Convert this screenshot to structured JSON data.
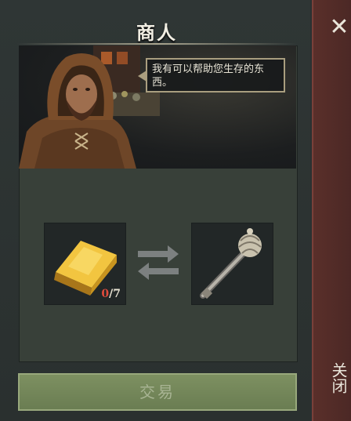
{
  "dialog": {
    "title": "商人",
    "speech": "我有可以帮助您生存的东西。"
  },
  "trade": {
    "offer_item": "gold-bar",
    "offer_have": "0",
    "offer_sep": "/",
    "offer_need": "7",
    "receive_item": "mace",
    "button_label": "交易"
  },
  "close": {
    "icon": "close-icon",
    "label": "关闭"
  },
  "colors": {
    "panel": "#2f3635",
    "button": "#7d9061",
    "close_strip": "#5a2f2a",
    "count_have": "#e14b3c",
    "speech_border": "#a99e7f"
  }
}
